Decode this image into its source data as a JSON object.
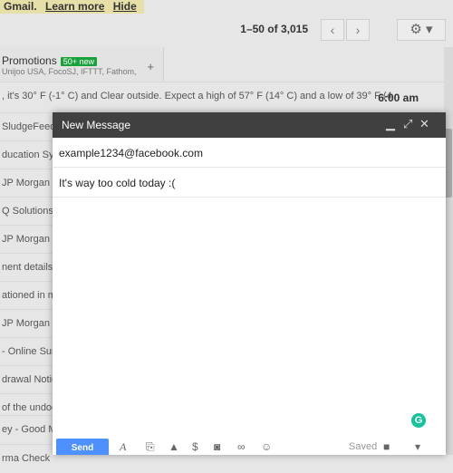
{
  "notice": {
    "brand": "Gmail.",
    "learn_more": "Learn more",
    "hide": "Hide"
  },
  "pager": {
    "text": "1–50 of 3,015",
    "prev": "‹",
    "next": "›",
    "settings_icon": "⚙"
  },
  "tab": {
    "title": "Promotions",
    "badge": "50+ new",
    "senders": "Unijoo USA, FocoSJ, IFTTT, Fathom,",
    "plus": "+"
  },
  "rows": [
    ", it's 30° F (-1° C) and Clear outside. Expect a high of 57° F (14° C) and a low of 39° F (4",
    "SludgeFeed,",
    "ducation Sys",
    "JP Morgan C",
    "Q Solutions, A",
    "JP Morgan C",
    "nent details.",
    "ationed in my",
    "JP Morgan C",
    "- Online Sur",
    "drawal Notice",
    "of the undocu",
    "ey - Good M",
    "rma Check"
  ],
  "first_row_time": "6:00 am",
  "compose": {
    "title": "New Message",
    "to": "example1234@facebook.com",
    "subject": "It's way too cold today :(",
    "send": "Send",
    "saved": "Saved",
    "grammarly": "G"
  }
}
